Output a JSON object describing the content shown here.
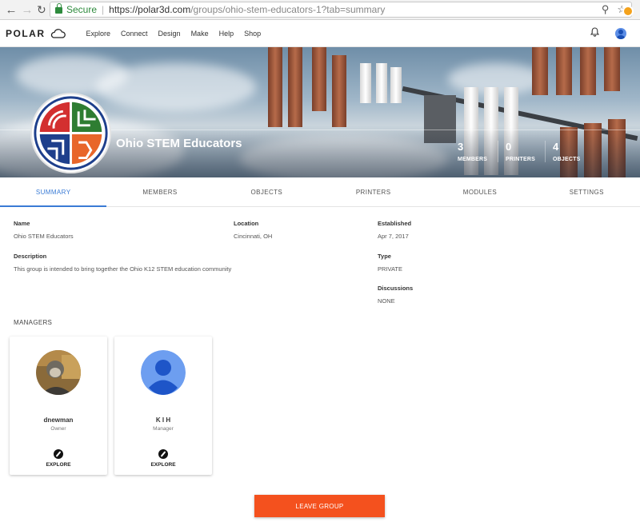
{
  "browser": {
    "secure_label": "Secure",
    "url_host": "https://polar3d.com",
    "url_path": "/groups/ohio-stem-educators-1?tab=summary"
  },
  "appbar": {
    "logo_text": "POLAR",
    "menu": [
      "Explore",
      "Connect",
      "Design",
      "Make",
      "Help",
      "Shop"
    ]
  },
  "hero": {
    "group_name": "Ohio STEM Educators",
    "stats": [
      {
        "value": "3",
        "label": "MEMBERS"
      },
      {
        "value": "0",
        "label": "PRINTERS"
      },
      {
        "value": "4",
        "label": "OBJECTS"
      }
    ]
  },
  "tabs": [
    {
      "label": "SUMMARY",
      "active": true
    },
    {
      "label": "MEMBERS"
    },
    {
      "label": "OBJECTS"
    },
    {
      "label": "PRINTERS"
    },
    {
      "label": "MODULES"
    },
    {
      "label": "SETTINGS"
    }
  ],
  "summary": {
    "name_label": "Name",
    "name_value": "Ohio STEM Educators",
    "location_label": "Location",
    "location_value": "Cincinnati, OH",
    "established_label": "Established",
    "established_value": "Apr 7, 2017",
    "description_label": "Description",
    "description_value": "This group is intended to bring together the Ohio K12 STEM education community",
    "type_label": "Type",
    "type_value": "PRIVATE",
    "discussions_label": "Discussions",
    "discussions_value": "NONE"
  },
  "managers": {
    "title": "MANAGERS",
    "cards": [
      {
        "name": "dnewman",
        "role": "Owner",
        "action": "EXPLORE"
      },
      {
        "name": "K I H",
        "role": "Manager",
        "action": "EXPLORE"
      }
    ]
  },
  "leave_button": "LEAVE GROUP",
  "colors": {
    "accent": "#3a7bd5",
    "leave": "#f4511e",
    "secure": "#2e8b3d"
  }
}
